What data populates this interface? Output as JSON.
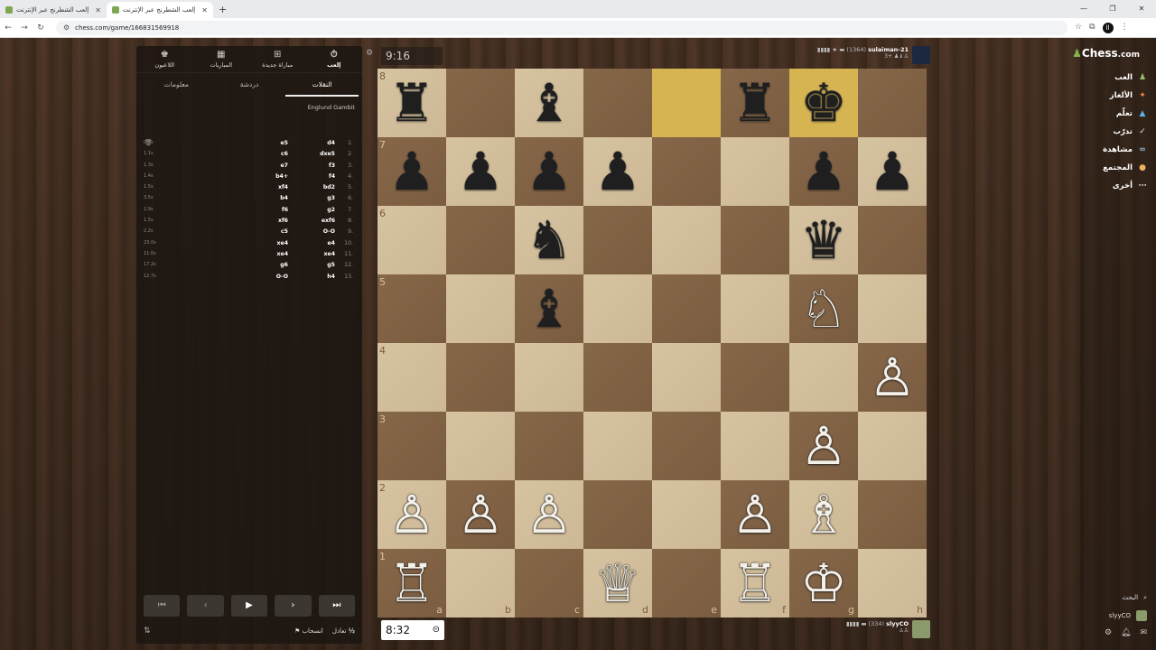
{
  "browser": {
    "tabs": [
      {
        "title": "إلعب الشطرنج عبر الإنترنت",
        "active": false
      },
      {
        "title": "إلعب الشطرنج عبر الإنترنت",
        "active": true
      }
    ],
    "url": "chess.com/game/166831569918"
  },
  "site_nav": {
    "logo": "Chess",
    "logo_suffix": ".com",
    "items": [
      {
        "label": "العب",
        "icon": "pawn-icon"
      },
      {
        "label": "الألغاز",
        "icon": "puzzle-icon"
      },
      {
        "label": "تعلّم",
        "icon": "graduation-cap-icon"
      },
      {
        "label": "تدرّب",
        "icon": "target-icon"
      },
      {
        "label": "مشاهدة",
        "icon": "binoculars-icon"
      },
      {
        "label": "المجتمع",
        "icon": "people-icon"
      },
      {
        "label": "أخرى",
        "icon": "more-icon"
      }
    ],
    "search_label": "البحث",
    "username": "slyyCO",
    "notifications_count": "1"
  },
  "panel": {
    "top_buttons": [
      {
        "label": "إلعب",
        "icon": "stopwatch-icon",
        "active": true
      },
      {
        "label": "مباراة جديدة",
        "icon": "plus-icon",
        "active": false
      },
      {
        "label": "المباريات",
        "icon": "grid-icon",
        "active": false
      },
      {
        "label": "اللاعبون",
        "icon": "players-icon",
        "active": false
      }
    ],
    "tabs": [
      "النقلات",
      "دردشة",
      "معلومات"
    ],
    "opening": "Englund Gambit",
    "moves": [
      {
        "num": "1.",
        "white": "d4",
        "black": "e5",
        "times": [
          "0.1s",
          "0.5s"
        ]
      },
      {
        "num": "2.",
        "white": "dxe5",
        "black": "c6",
        "times": [
          "1.1s",
          "1.1s"
        ]
      },
      {
        "num": "3.",
        "white": "f3",
        "black": "e7",
        "times": [
          "1.3s",
          "1.0s"
        ]
      },
      {
        "num": "4.",
        "white": "f4",
        "black": "b4+",
        "times": [
          "1.4s",
          "1.5s"
        ]
      },
      {
        "num": "5.",
        "white": "bd2",
        "black": "xf4",
        "times": [
          "1.5s",
          "1.1s"
        ]
      },
      {
        "num": "6.",
        "white": "g3",
        "black": "b4",
        "times": [
          "3.5s",
          "9.3s"
        ]
      },
      {
        "num": "7.",
        "white": "g2",
        "black": "f6",
        "times": [
          "2.9s",
          "5.8s"
        ]
      },
      {
        "num": "8.",
        "white": "exf6",
        "black": "xf6",
        "times": [
          "1.5s",
          "1.6s"
        ]
      },
      {
        "num": "9.",
        "white": "O-O",
        "black": "c5",
        "times": [
          "2.2s",
          "5.3s"
        ]
      },
      {
        "num": "10.",
        "white": "e4",
        "black": "xe4",
        "times": [
          "23.0s",
          "5.0s"
        ]
      },
      {
        "num": "11.",
        "white": "xe4",
        "black": "xe4",
        "times": [
          "11.0s",
          "2.3s"
        ]
      },
      {
        "num": "12.",
        "white": "g5",
        "black": "g6",
        "times": [
          "17.2s",
          "8.2s"
        ]
      },
      {
        "num": "13.",
        "white": "h4",
        "black": "O-O",
        "times": [
          "12.7s",
          "6.2s"
        ]
      }
    ],
    "draw_label": "تعادل",
    "resign_label": "انسحاب",
    "half_symbol": "½"
  },
  "game": {
    "top_player": {
      "name": "sulaiman-21",
      "rating": "(1364)",
      "captured_text": "3+"
    },
    "bottom_player": {
      "name": "slyyCO",
      "rating": "(334)"
    },
    "top_clock": "9:16",
    "bottom_clock": "8:32",
    "files": [
      "a",
      "b",
      "c",
      "d",
      "e",
      "f",
      "g",
      "h"
    ],
    "ranks": [
      "8",
      "7",
      "6",
      "5",
      "4",
      "3",
      "2",
      "1"
    ],
    "highlight": [
      "e8",
      "g8"
    ],
    "pieces": {
      "a8": "♜",
      "c8": "♝",
      "f8": "♜",
      "g8": "♚",
      "a7": "♟",
      "b7": "♟",
      "c7": "♟",
      "d7": "♟",
      "g7": "♟",
      "h7": "♟",
      "c6": "♞",
      "g6": "♛",
      "c5": "♝",
      "g5": "♘",
      "h4": "♙",
      "g3": "♙",
      "a2": "♙",
      "b2": "♙",
      "c2": "♙",
      "f2": "♙",
      "g2": "♗",
      "a1": "♖",
      "d1": "♕",
      "f1": "♖",
      "g1": "♔"
    }
  },
  "colors": {
    "accent": "#81b64c",
    "highlight": "#d6b452",
    "light_square": "#d6c3a0",
    "dark_square": "#876749"
  }
}
